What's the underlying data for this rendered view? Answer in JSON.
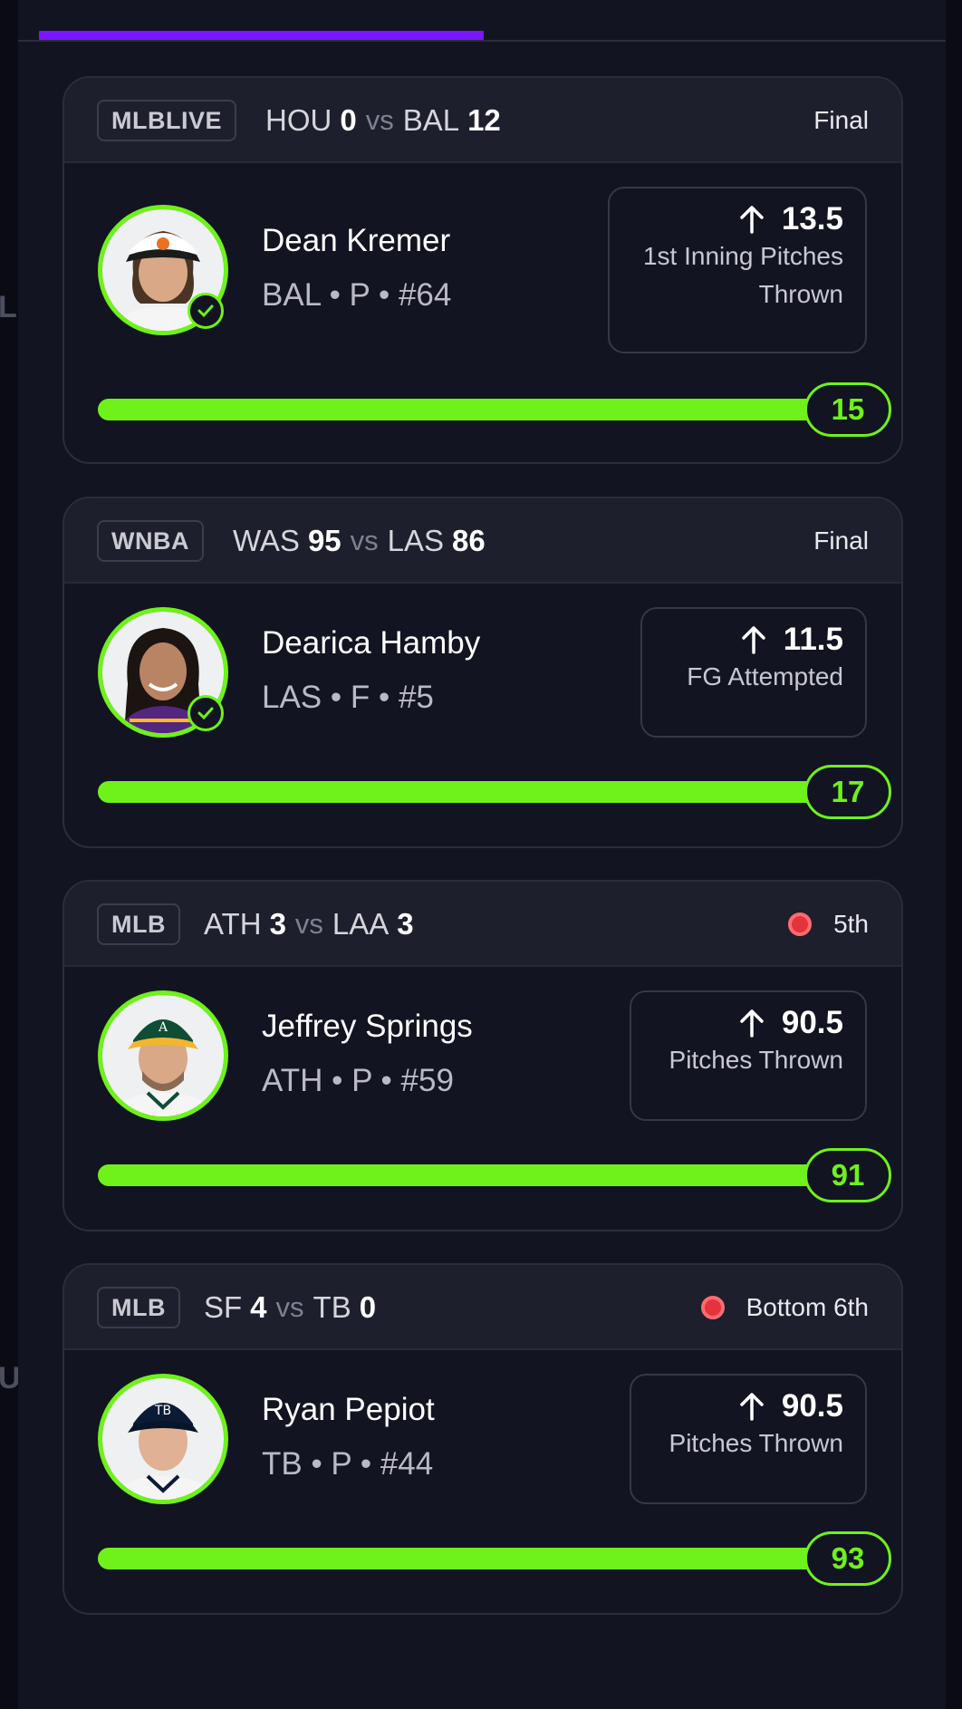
{
  "colors": {
    "accent_green": "#6ef21a",
    "progress_purple": "#7a16ff",
    "live_red": "#e5323d",
    "background": "#121421"
  },
  "edge_glyphs": [
    "L",
    "U"
  ],
  "cards": [
    {
      "league": "MLBLIVE",
      "away_team": "HOU",
      "away_score": "0",
      "vs": "vs",
      "home_team": "BAL",
      "home_score": "12",
      "status": "Final",
      "live": false,
      "player_name": "Dean Kremer",
      "player_info": "BAL • P • #64",
      "verified": true,
      "direction": "up",
      "line": "13.5",
      "stat_line1": "1st Inning Pitches",
      "stat_line2": "Thrown",
      "result": "15",
      "progress": 1.0
    },
    {
      "league": "WNBA",
      "away_team": "WAS",
      "away_score": "95",
      "vs": "vs",
      "home_team": "LAS",
      "home_score": "86",
      "status": "Final",
      "live": false,
      "player_name": "Dearica Hamby",
      "player_info": "LAS • F • #5",
      "verified": true,
      "direction": "up",
      "line": "11.5",
      "stat_line1": "FG Attempted",
      "stat_line2": "",
      "result": "17",
      "progress": 1.0
    },
    {
      "league": "MLB",
      "away_team": "ATH",
      "away_score": "3",
      "vs": "vs",
      "home_team": "LAA",
      "home_score": "3",
      "status": "5th",
      "live": true,
      "player_name": "Jeffrey Springs",
      "player_info": "ATH • P • #59",
      "verified": false,
      "direction": "up",
      "line": "90.5",
      "stat_line1": "Pitches Thrown",
      "stat_line2": "",
      "result": "91",
      "progress": 1.0
    },
    {
      "league": "MLB",
      "away_team": "SF",
      "away_score": "4",
      "vs": "vs",
      "home_team": "TB",
      "home_score": "0",
      "status": "Bottom 6th",
      "live": true,
      "player_name": "Ryan Pepiot",
      "player_info": "TB • P • #44",
      "verified": false,
      "direction": "up",
      "line": "90.5",
      "stat_line1": "Pitches Thrown",
      "stat_line2": "",
      "result": "93",
      "progress": 1.0
    }
  ]
}
